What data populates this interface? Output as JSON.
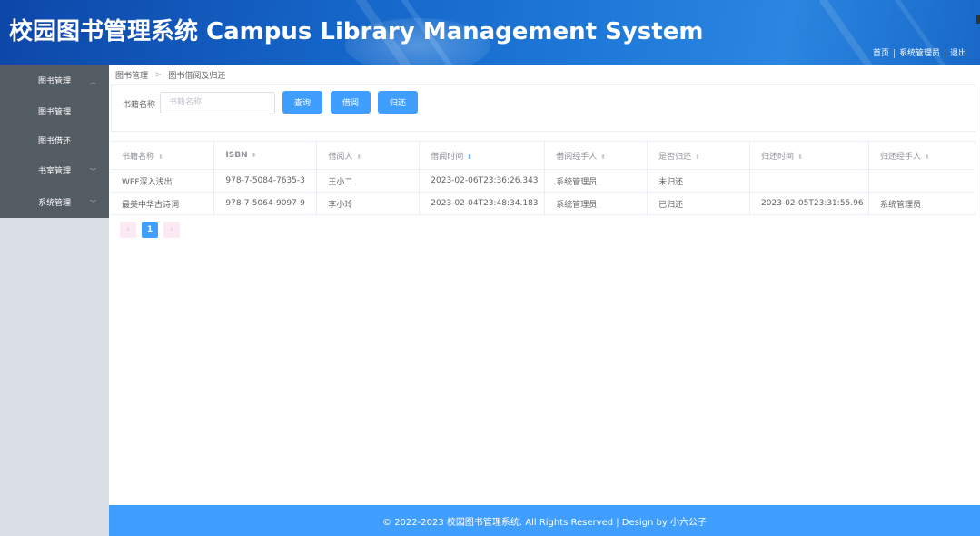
{
  "header": {
    "title": "校园图书管理系统 Campus Library Management System",
    "nav": {
      "home": "首页",
      "user": "系统管理员",
      "logout": "退出"
    }
  },
  "sidebar": {
    "menus": [
      {
        "label": "图书管理",
        "expanded": true,
        "children": [
          "图书管理",
          "图书借还"
        ]
      },
      {
        "label": "书室管理",
        "expanded": false
      },
      {
        "label": "系统管理",
        "expanded": false
      }
    ],
    "arrows": {
      "up": "︿",
      "down": "﹀"
    }
  },
  "breadcrumb": {
    "root": "图书管理",
    "sep": ">",
    "current": "图书借阅及归还"
  },
  "search": {
    "label": "书籍名称",
    "placeholder": "书籍名称",
    "query_label": "查询",
    "borrow_label": "借阅",
    "return_label": "归还"
  },
  "table": {
    "columns": [
      "书籍名称",
      "ISBN",
      "借阅人",
      "借阅时间",
      "借阅经手人",
      "是否归还",
      "归还时间",
      "归还经手人"
    ],
    "sort_glyph": "⬍",
    "sort_active_glyph": "⬍",
    "rows": [
      [
        "WPF深入浅出",
        "978-7-5084-7635-3",
        "王小二",
        "2023-02-06T23:36:26.343",
        "系统管理员",
        "未归还",
        "",
        ""
      ],
      [
        "最美中华古诗词",
        "978-7-5064-9097-9",
        "李小玲",
        "2023-02-04T23:48:34.183",
        "系统管理员",
        "已归还",
        "2023-02-05T23:31:55.96",
        "系统管理员"
      ]
    ]
  },
  "pagination": {
    "prev": "‹",
    "current": "1",
    "next": "›"
  },
  "footer": {
    "text": "© 2022-2023 校园图书管理系统. All Rights Reserved | Design by 小六公子"
  },
  "colors": {
    "primary": "#409eff",
    "sidebar_menu": "#545c64",
    "sidebar_bg": "#dadfe6"
  }
}
